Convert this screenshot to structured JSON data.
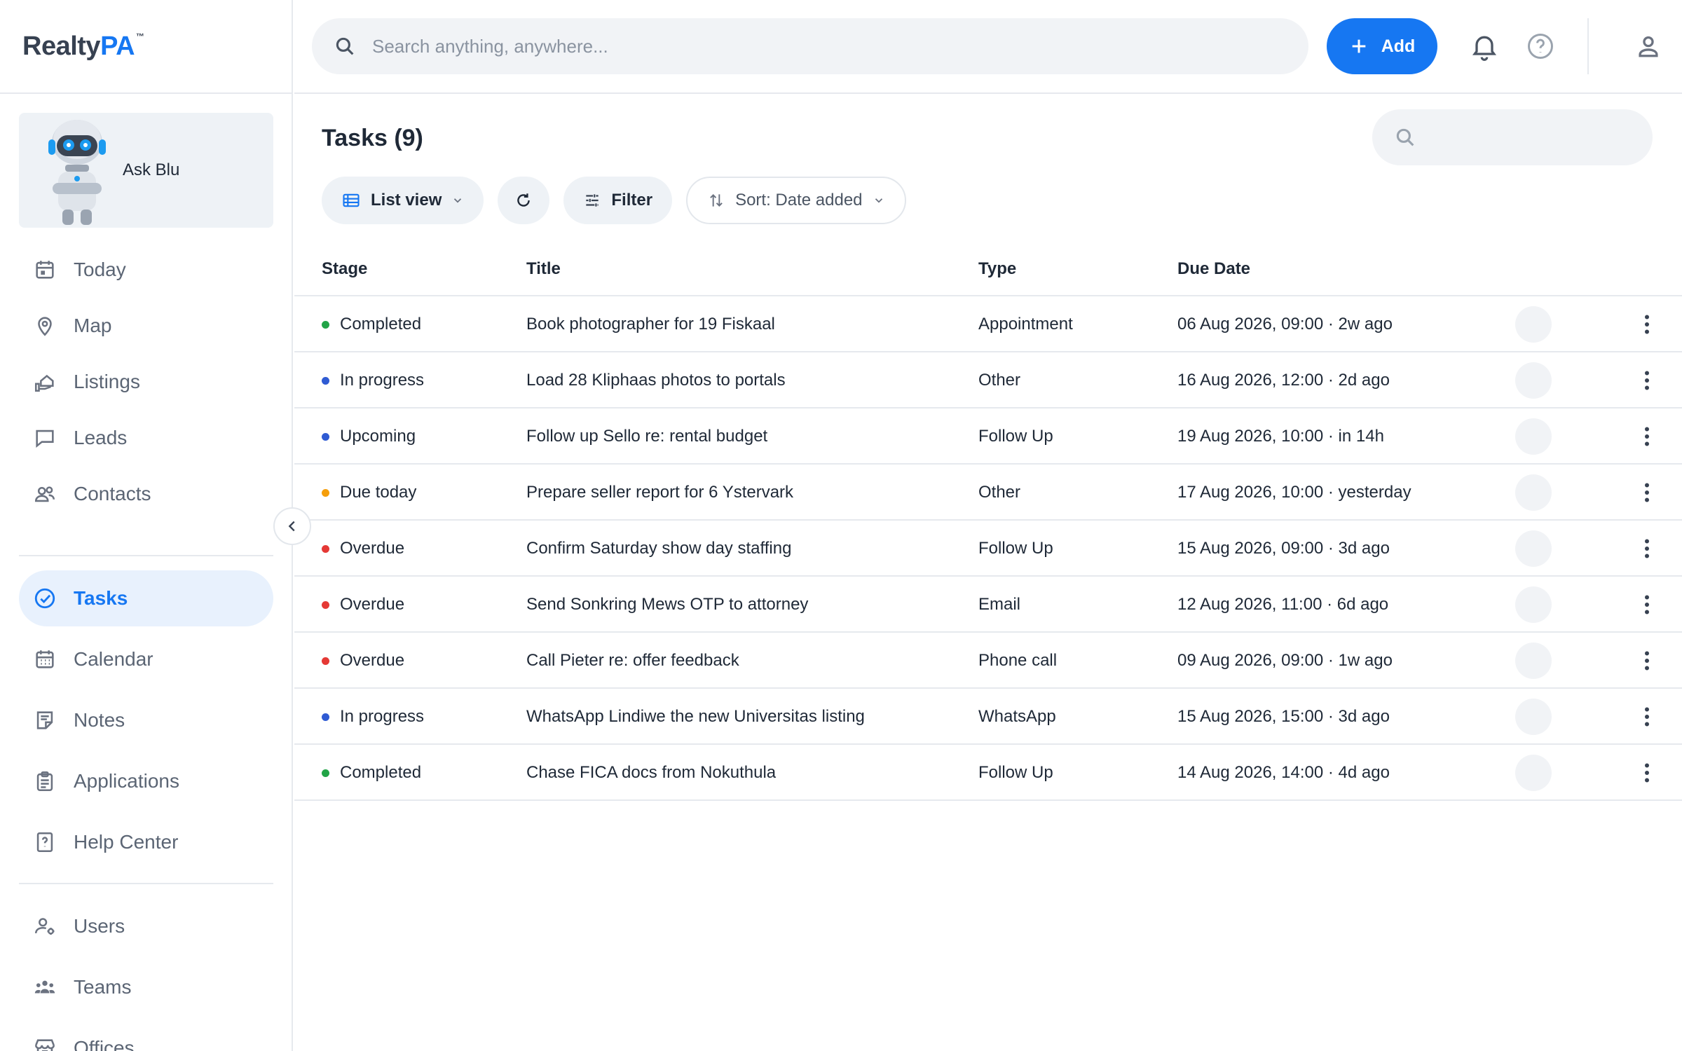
{
  "app": {
    "logo_main": "Realty",
    "logo_accent": "PA",
    "logo_tm": "™"
  },
  "sidebar": {
    "ask_label": "Ask Blu",
    "collapse_icon": "chevron-left-icon",
    "items": [
      {
        "label": "Today",
        "icon": "calendar-day-icon"
      },
      {
        "label": "Map",
        "icon": "map-pin-icon"
      },
      {
        "label": "Listings",
        "icon": "house-hand-icon"
      },
      {
        "label": "Leads",
        "icon": "chat-bubble-icon"
      },
      {
        "label": "Contacts",
        "icon": "people-icon"
      },
      {
        "label": "Tasks",
        "icon": "check-circle-icon",
        "active": true
      },
      {
        "label": "Calendar",
        "icon": "calendar-grid-icon"
      },
      {
        "label": "Notes",
        "icon": "note-icon"
      },
      {
        "label": "Applications",
        "icon": "clipboard-icon"
      },
      {
        "label": "Help Center",
        "icon": "question-box-icon"
      },
      {
        "label": "Users",
        "icon": "user-gear-icon"
      },
      {
        "label": "Teams",
        "icon": "team-icon"
      },
      {
        "label": "Offices",
        "icon": "store-icon"
      }
    ]
  },
  "topbar": {
    "search_placeholder": "Search anything, anywhere...",
    "add_label": "Add",
    "icons": [
      "bell-icon",
      "help-circle-icon",
      "user-icon"
    ]
  },
  "tasks": {
    "title": "Tasks (9)",
    "toolbar": {
      "view_label": "List view",
      "filter_label": "Filter",
      "sort_label": "Sort: Date added"
    },
    "columns": {
      "stage": "Stage",
      "title": "Title",
      "type": "Type",
      "due": "Due Date"
    },
    "status_colors": {
      "Completed": "#22a447",
      "In progress": "#2f5bd3",
      "Upcoming": "#2f5bd3",
      "Due today": "#f59e0b",
      "Overdue": "#e53935"
    },
    "rows": [
      {
        "stage": "Completed",
        "title": "Book photographer for 19 Fiskaal",
        "type": "Appointment",
        "due": "06 Aug 2026, 09:00 · 2w ago"
      },
      {
        "stage": "In progress",
        "title": "Load 28 Kliphaas photos to portals",
        "type": "Other",
        "due": "16 Aug 2026, 12:00 · 2d ago"
      },
      {
        "stage": "Upcoming",
        "title": "Follow up Sello re: rental budget",
        "type": "Follow Up",
        "due": "19 Aug 2026, 10:00 · in 14h"
      },
      {
        "stage": "Due today",
        "title": "Prepare seller report for 6 Ystervark",
        "type": "Other",
        "due": "17 Aug 2026, 10:00 · yesterday"
      },
      {
        "stage": "Overdue",
        "title": "Confirm Saturday show day staffing",
        "type": "Follow Up",
        "due": "15 Aug 2026, 09:00 · 3d ago"
      },
      {
        "stage": "Overdue",
        "title": "Send Sonkring Mews OTP to attorney",
        "type": "Email",
        "due": "12 Aug 2026, 11:00 · 6d ago"
      },
      {
        "stage": "Overdue",
        "title": "Call Pieter re: offer feedback",
        "type": "Phone call",
        "due": "09 Aug 2026, 09:00 · 1w ago"
      },
      {
        "stage": "In progress",
        "title": "WhatsApp Lindiwe the new Universitas listing",
        "type": "WhatsApp",
        "due": "15 Aug 2026, 15:00 · 3d ago"
      },
      {
        "stage": "Completed",
        "title": "Chase FICA docs from Nokuthula",
        "type": "Follow Up",
        "due": "14 Aug 2026, 14:00 · 4d ago"
      }
    ]
  }
}
